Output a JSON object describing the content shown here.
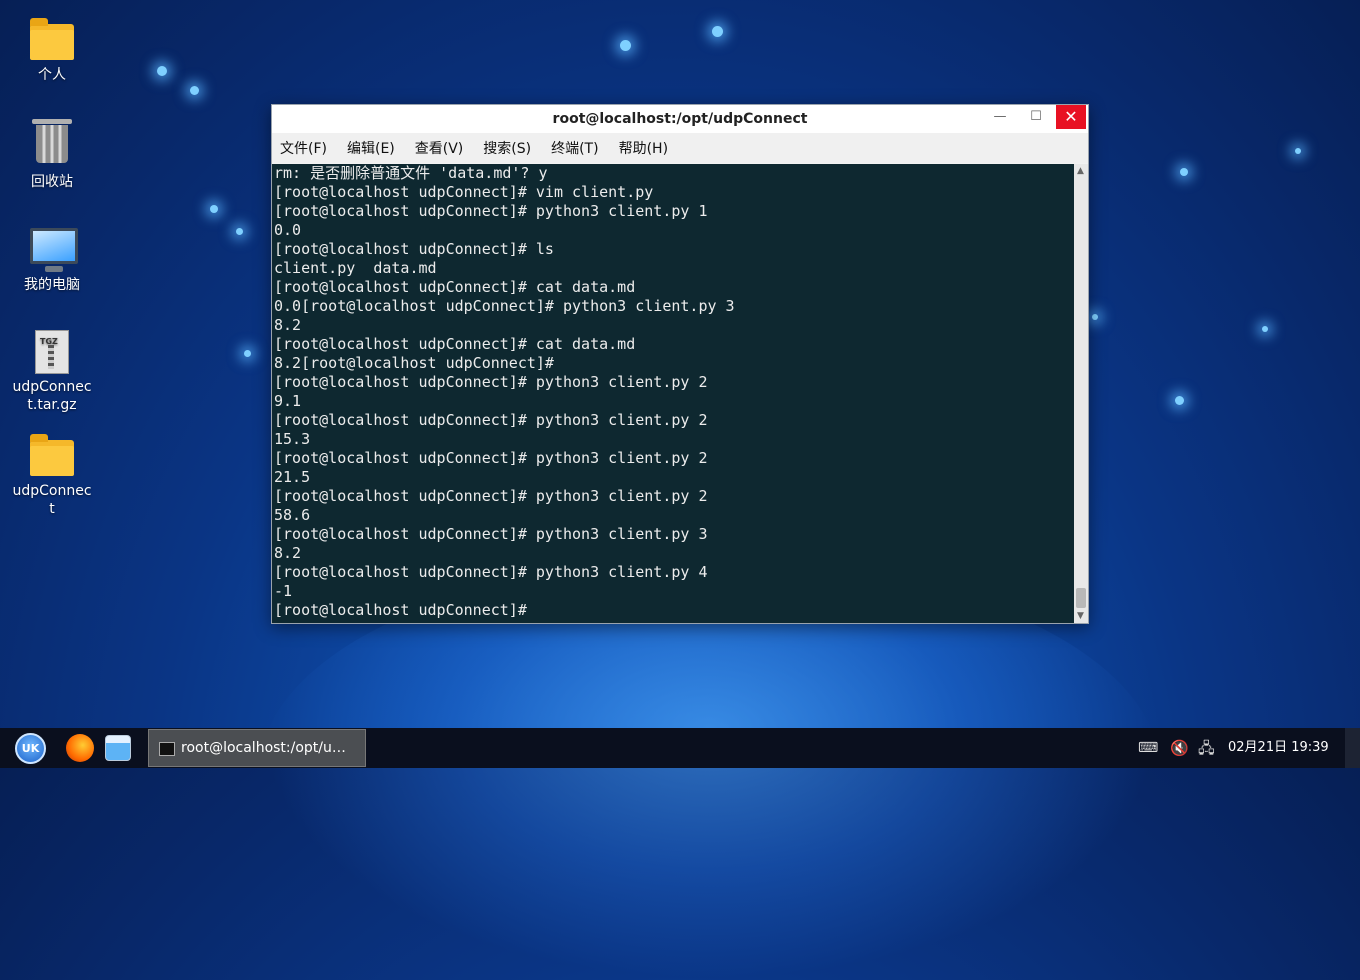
{
  "desktop": {
    "icons": [
      {
        "label": "个人",
        "kind": "folder-home"
      },
      {
        "label": "回收站",
        "kind": "trash"
      },
      {
        "label": "我的电脑",
        "kind": "computer"
      },
      {
        "label": "udpConnect.tar.gz",
        "kind": "archive",
        "badge": "TGZ"
      },
      {
        "label": "udpConnect",
        "kind": "folder"
      }
    ]
  },
  "window": {
    "title": "root@localhost:/opt/udpConnect",
    "controls": {
      "minimize": "—",
      "maximize": "☐",
      "close": "✕"
    },
    "menu": [
      "文件(F)",
      "编辑(E)",
      "查看(V)",
      "搜索(S)",
      "终端(T)",
      "帮助(H)"
    ],
    "terminal_lines": [
      "rm: 是否删除普通文件 'data.md'? y",
      "[root@localhost udpConnect]# vim client.py",
      "[root@localhost udpConnect]# python3 client.py 1",
      "0.0",
      "[root@localhost udpConnect]# ls",
      "client.py  data.md",
      "[root@localhost udpConnect]# cat data.md",
      "0.0[root@localhost udpConnect]# python3 client.py 3",
      "8.2",
      "[root@localhost udpConnect]# cat data.md",
      "8.2[root@localhost udpConnect]#",
      "[root@localhost udpConnect]# python3 client.py 2",
      "9.1",
      "[root@localhost udpConnect]# python3 client.py 2",
      "15.3",
      "[root@localhost udpConnect]# python3 client.py 2",
      "21.5",
      "[root@localhost udpConnect]# python3 client.py 2",
      "58.6",
      "[root@localhost udpConnect]# python3 client.py 3",
      "8.2",
      "[root@localhost udpConnect]# python3 client.py 4",
      "-1",
      "[root@localhost udpConnect]# "
    ]
  },
  "taskbar": {
    "start_label": "UK",
    "task_title": "root@localhost:/opt/u…",
    "clock": "02月21日 19:39",
    "tray_icons": [
      "keyboard-icon",
      "volume-muted-icon",
      "network-icon"
    ]
  },
  "colors": {
    "terminal_bg": "#0e2830",
    "terminal_fg": "#ececec",
    "close_button": "#e81123",
    "taskbar_bg": "#0a0f1e"
  }
}
